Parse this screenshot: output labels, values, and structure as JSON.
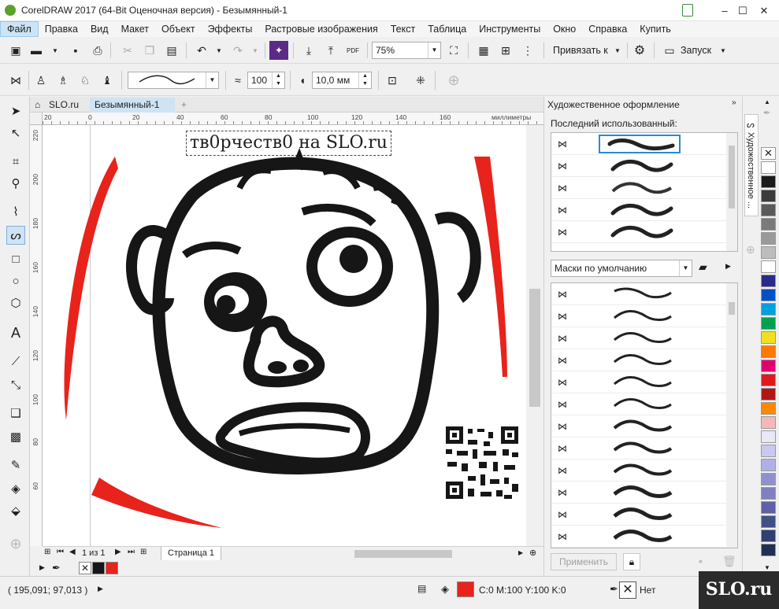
{
  "window": {
    "title": "CorelDRAW 2017 (64-Bit Оценочная версия) - Безымянный-1",
    "controls": [
      "–",
      "☐",
      "✕"
    ]
  },
  "menu": [
    "Файл",
    "Правка",
    "Вид",
    "Макет",
    "Объект",
    "Эффекты",
    "Растровые изображения",
    "Текст",
    "Таблица",
    "Инструменты",
    "Окно",
    "Справка",
    "Купить"
  ],
  "standard_toolbar": {
    "zoom_value": "75%",
    "snap_label": "Привязать к",
    "launch_label": "Запуск",
    "pdf_label": "PDF"
  },
  "property_bar": {
    "smoothness_value": "100",
    "width_value": "10,0 мм"
  },
  "doc_tabs": [
    "SLO.ru",
    "Безымянный-1"
  ],
  "ruler": {
    "h_unit": "миллиметры",
    "h_ticks": [
      "20",
      "0",
      "20",
      "40",
      "60",
      "80",
      "100",
      "120",
      "140",
      "160"
    ],
    "v_ticks": [
      "220",
      "200",
      "180",
      "160",
      "140",
      "120",
      "100",
      "80",
      "60"
    ]
  },
  "canvas": {
    "text": "тв0рчеств0 на SLO.ru"
  },
  "page_nav": {
    "page_count": "1 из 1",
    "page_tab": "Страница 1"
  },
  "docker": {
    "title": "Художественное оформление",
    "recent_label": "Последний использованный:",
    "category_value": "Маски по умолчанию",
    "apply_label": "Применить",
    "tab_label": "Художественное ...",
    "brush_icon": "bowtie-icon"
  },
  "palette_colors": [
    "#ffffff",
    "#1a1a1a",
    "#3b3b3b",
    "#5a5a5a",
    "#7a7a7a",
    "#9a9a9a",
    "#bdbdbd",
    "#ffffff",
    "#2a2a8a",
    "#0050c8",
    "#00a0e0",
    "#00a050",
    "#f0e020",
    "#ff7800",
    "#e00070",
    "#e01a1a",
    "#b01818",
    "#ff8800",
    "#f5b8b8",
    "#e8e8f8",
    "#c8c8f0",
    "#b0b0e8",
    "#9090d0",
    "#8080c0",
    "#6060a8",
    "#405088",
    "#304070",
    "#203050"
  ],
  "status": {
    "coords": "( 195,091; 97,013 )",
    "fill_text": "C:0 M:100 Y:100 K:0",
    "outline_text": "Нет",
    "fill_color": "#e8231c",
    "watermark": "SLO.ru"
  }
}
